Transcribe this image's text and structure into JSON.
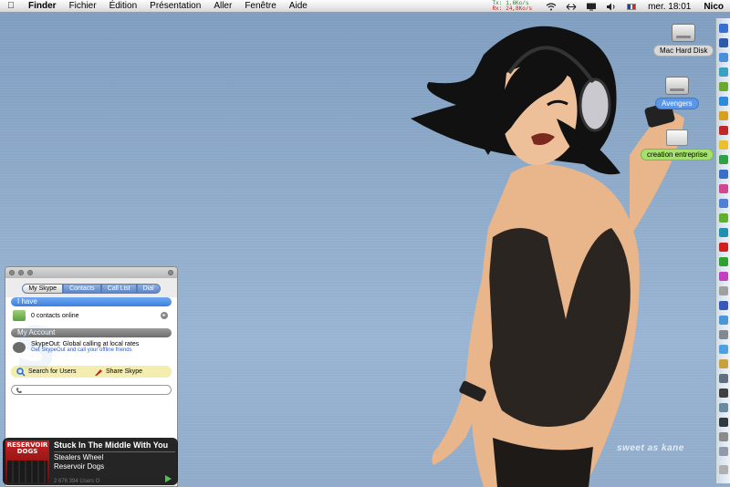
{
  "menubar": {
    "apple_icon": "apple-icon",
    "items": [
      "Finder",
      "Fichier",
      "Édition",
      "Présentation",
      "Aller",
      "Fenêtre",
      "Aide"
    ],
    "net_tx_label": "Tx:",
    "net_tx_value": "1,6Ko/s",
    "net_rx_label": "Rx:",
    "net_rx_value": "24,8Ko/s",
    "clock": "mer. 18:01",
    "user": "Nico"
  },
  "desktop": {
    "icons": [
      {
        "label": "Mac Hard Disk"
      },
      {
        "label": "Avengers"
      },
      {
        "label": "creation entreprise"
      }
    ],
    "watermark": "sweet as kane"
  },
  "skype": {
    "tabs": [
      "My Skype",
      "Contacts",
      "Call List",
      "Dial"
    ],
    "section_have": "I have",
    "contacts_online": "0 contacts online",
    "section_account": "My Account",
    "skypeout_title": "SkypeOut: Global calling at local rates",
    "skypeout_link": "Get SkypeOut and call your offline friends",
    "search_users": "Search for Users",
    "share_skype": "Share Skype",
    "users_online_partial": "2 676 394 Users O"
  },
  "notification": {
    "album_art_text": "RESERVOIR DOGS",
    "track": "Stuck In The Middle With You",
    "artist": "Stealers Wheel",
    "album": "Reservoir Dogs"
  },
  "colors": {
    "desktop": "#8eabca",
    "skype_blue": "#3b7fe0",
    "notification_bg": "#141414"
  }
}
